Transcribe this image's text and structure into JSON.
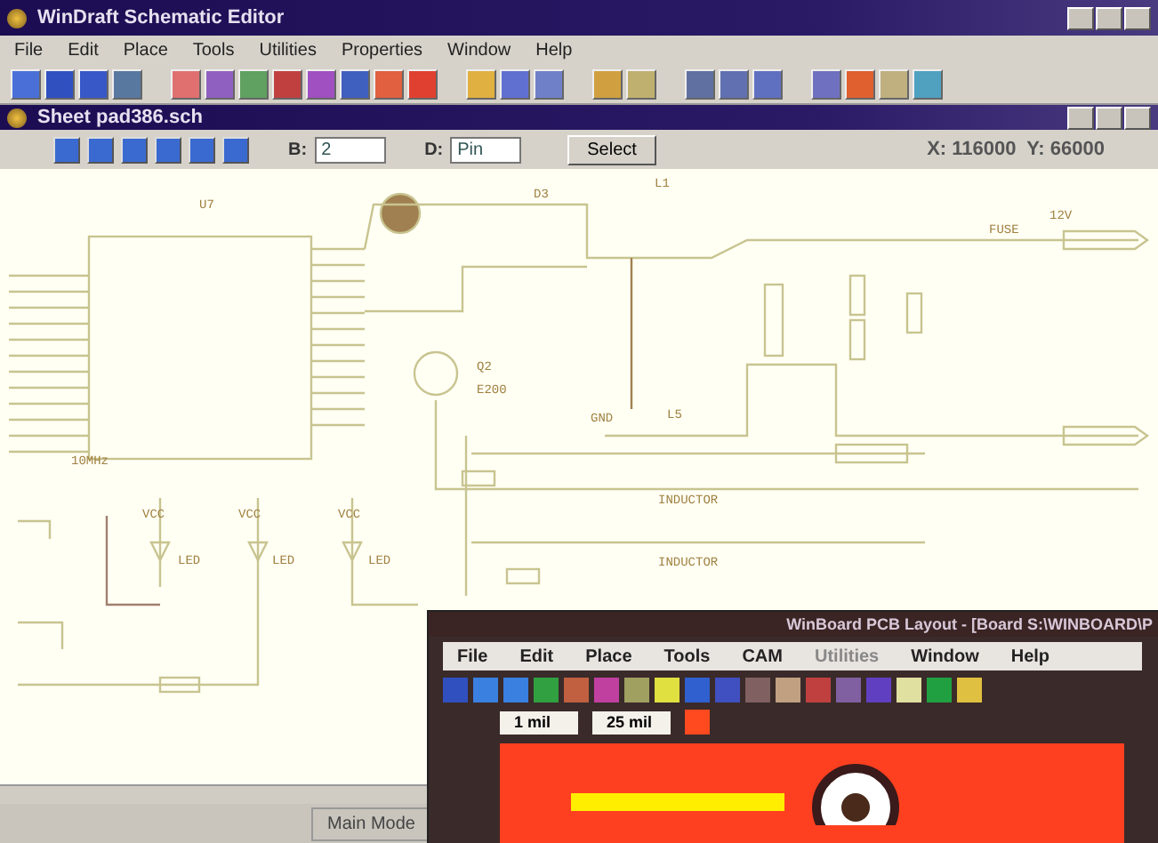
{
  "window": {
    "title": "WinDraft Schematic Editor"
  },
  "menu": [
    "File",
    "Edit",
    "Place",
    "Tools",
    "Utilities",
    "Properties",
    "Window",
    "Help"
  ],
  "sheet": {
    "title": "Sheet pad386.sch",
    "fields": [
      {
        "label": "B:",
        "value": "2"
      },
      {
        "label": "D:",
        "value": "Pin"
      }
    ],
    "select_button": "Select",
    "coords": "X: 116000  Y: 66000"
  },
  "schematic": {
    "labels": [
      "U7",
      "Q2",
      "E200",
      "VCC",
      "VCC",
      "VCC",
      "LED",
      "LED",
      "LED",
      "INDUCTOR",
      "INDUCTOR",
      "L5",
      "FUSE",
      "12V",
      "GND",
      "10MHz",
      "L1",
      "D3"
    ]
  },
  "status_bar": {
    "mode": "Main Mode"
  },
  "pcb": {
    "title": "WinBoard PCB Layout - [Board S:\\WINBOARD\\P",
    "menu": [
      {
        "label": "File",
        "disabled": false
      },
      {
        "label": "Edit",
        "disabled": false
      },
      {
        "label": "Place",
        "disabled": false
      },
      {
        "label": "Tools",
        "disabled": false
      },
      {
        "label": "CAM",
        "disabled": false
      },
      {
        "label": "Utilities",
        "disabled": true
      },
      {
        "label": "Window",
        "disabled": false
      },
      {
        "label": "Help",
        "disabled": false
      }
    ],
    "fields": [
      "1 mil",
      "25 mil"
    ]
  }
}
